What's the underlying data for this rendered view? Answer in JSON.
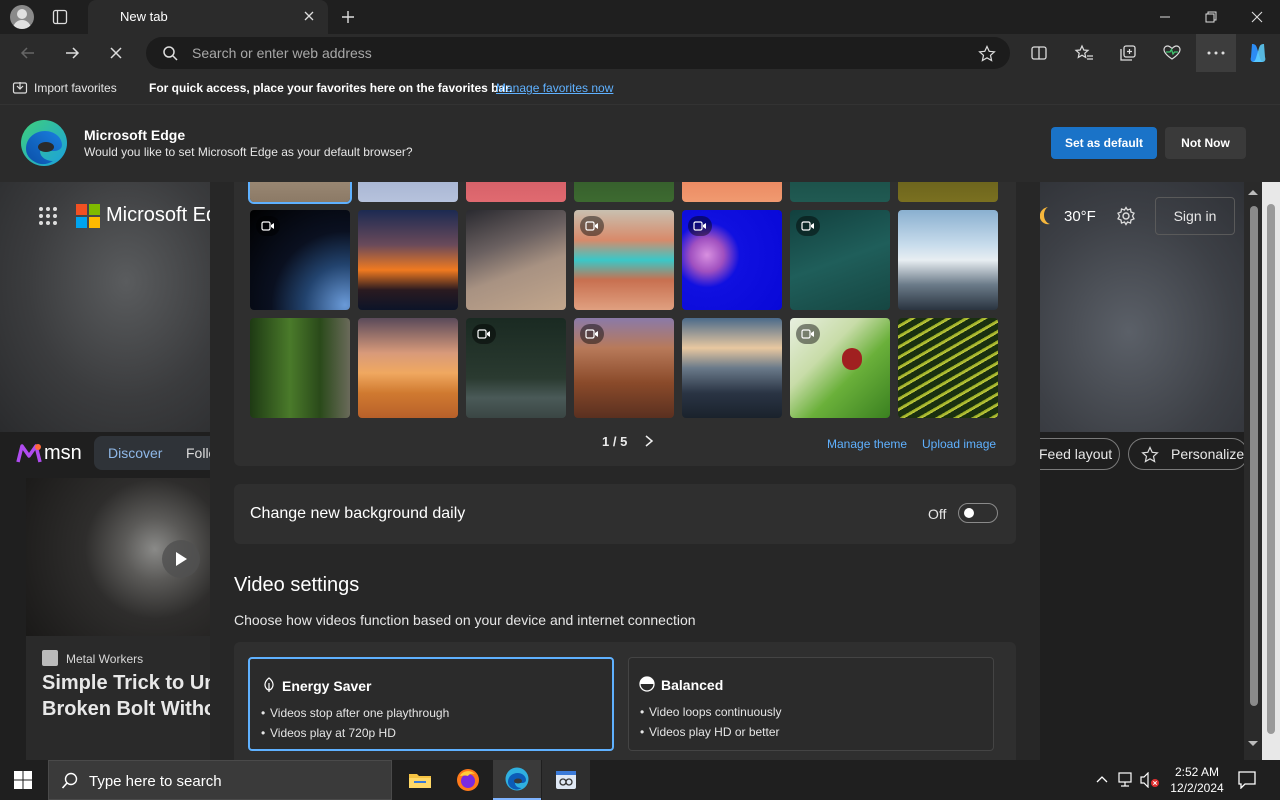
{
  "browser": {
    "tab_title": "New tab",
    "address_placeholder": "Search or enter web address"
  },
  "favorites_bar": {
    "import_label": "Import favorites",
    "message": "For quick access, place your favorites here on the favorites bar.",
    "manage_link": "Manage favorites now"
  },
  "infobar": {
    "title": "Microsoft Edge",
    "message": "Would you like to set Microsoft Edge as your default browser?",
    "primary_button": "Set as default",
    "secondary_button": "Not Now"
  },
  "page": {
    "brand": "Microsoft Ed",
    "weather_temp": "30°F",
    "sign_in": "Sign in",
    "msn_logo": "msn",
    "tabs": [
      "Discover",
      "Follo"
    ],
    "feed_layout": "Feed layout",
    "personalize": "Personalize",
    "card_source": "Metal Workers",
    "card_headline": "Simple Trick to Unscrew a Broken Bolt Without",
    "card_headline_line1": "Simple Trick to Un",
    "card_headline_line2": "Broken Bolt Witho"
  },
  "settings": {
    "pager": "1 / 5",
    "manage_theme": "Manage theme",
    "upload_image": "Upload image",
    "daily_label": "Change new background daily",
    "daily_state": "Off",
    "video_title": "Video settings",
    "video_desc": "Choose how videos function based on your device and internet connection",
    "options": [
      {
        "title": "Energy Saver",
        "bullets": [
          "Videos stop after one playthrough",
          "Videos play at 720p HD"
        ]
      },
      {
        "title": "Balanced",
        "bullets": [
          "Video loops continuously",
          "Videos play HD or better"
        ]
      }
    ]
  },
  "taskbar": {
    "search_placeholder": "Type here to search",
    "time": "2:52 AM",
    "date": "12/2/2024"
  },
  "colors": {
    "accent": "#1a73c8",
    "link": "#5fb1ff"
  }
}
